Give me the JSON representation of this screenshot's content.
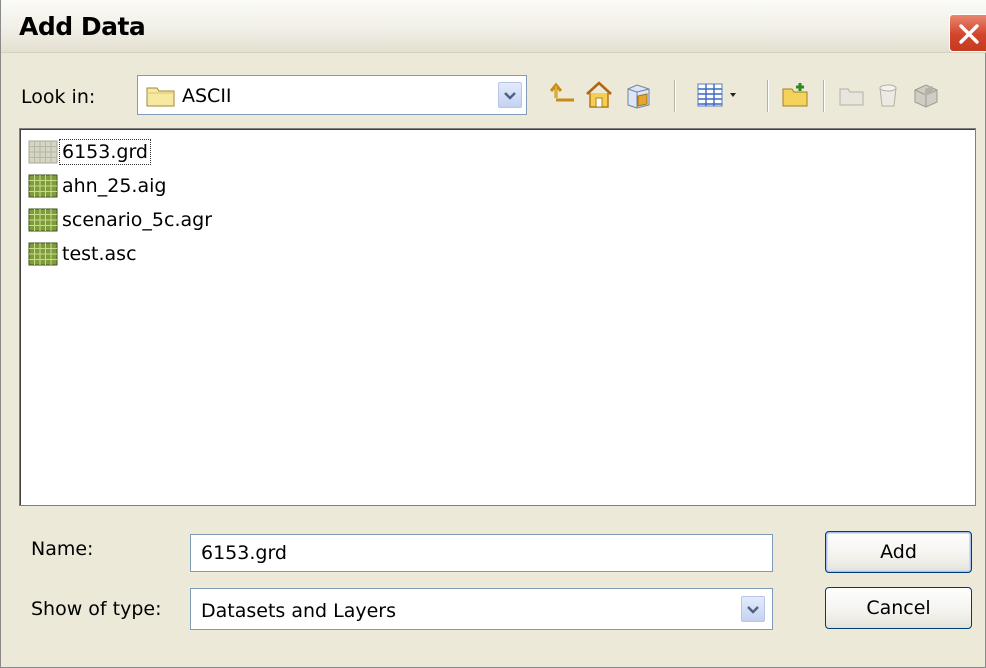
{
  "window": {
    "title": "Add Data"
  },
  "lookin": {
    "label": "Look in:",
    "value": "ASCII"
  },
  "toolbar": {
    "icons": [
      "up-one-level-icon",
      "home-icon",
      "catalog-icon",
      "view-menu-icon",
      "new-folder-icon",
      "disconnect-folder-icon",
      "delete-icon",
      "properties-icon"
    ]
  },
  "files": [
    {
      "label": "6153.grd",
      "selected": true
    },
    {
      "label": "ahn_25.aig",
      "selected": false
    },
    {
      "label": "scenario_5c.agr",
      "selected": false
    },
    {
      "label": "test.asc",
      "selected": false
    }
  ],
  "name_field": {
    "label": "Name:",
    "value": "6153.grd"
  },
  "type_field": {
    "label": "Show of type:",
    "value": "Datasets and Layers"
  },
  "buttons": {
    "add": "Add",
    "cancel": "Cancel"
  },
  "colors": {
    "dialog_bg": "#ece9d8",
    "close_red": "#d2452b",
    "border_blue": "#7f9db9"
  }
}
